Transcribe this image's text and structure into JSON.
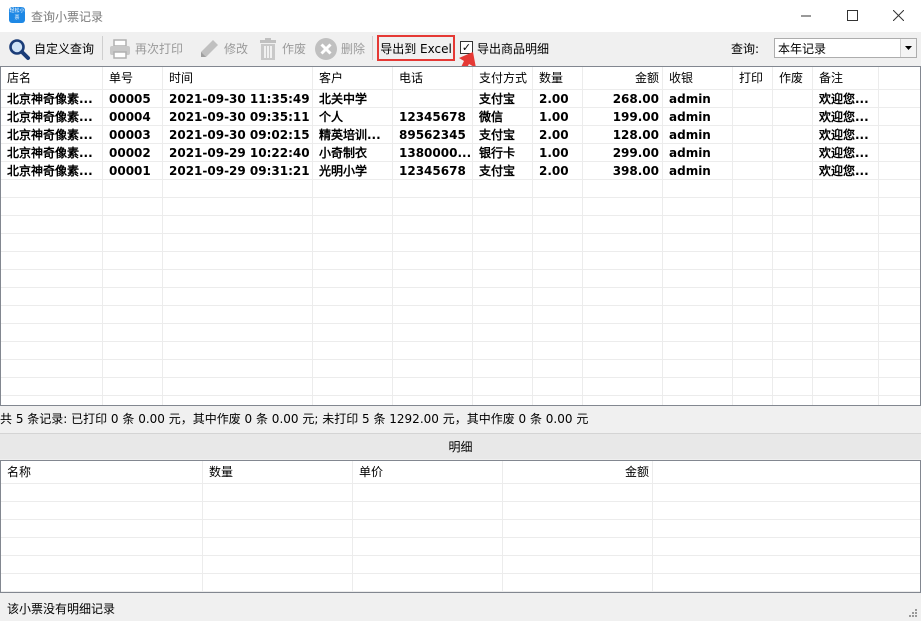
{
  "window": {
    "title": "查询小票记录",
    "icon_text": "轻松小票"
  },
  "toolbar": {
    "custom_query": "自定义查询",
    "reprint": "再次打印",
    "edit": "修改",
    "void": "作废",
    "delete": "删除",
    "export_excel": "导出到 Excel",
    "export_detail_label": "导出商品明细",
    "export_detail_checked": true,
    "query_label": "查询:",
    "query_value": "本年记录"
  },
  "main_table": {
    "columns": [
      "店名",
      "单号",
      "时间",
      "客户",
      "电话",
      "支付方式",
      "数量",
      "金额",
      "收银",
      "打印",
      "作废",
      "备注"
    ],
    "rows": [
      [
        "北京神奇像素...",
        "00005",
        "2021-09-30 11:35:49",
        "北关中学",
        "",
        "支付宝",
        "2.00",
        "268.00",
        "admin",
        "",
        "",
        "欢迎您..."
      ],
      [
        "北京神奇像素...",
        "00004",
        "2021-09-30 09:35:11",
        "个人",
        "12345678",
        "微信",
        "1.00",
        "199.00",
        "admin",
        "",
        "",
        "欢迎您..."
      ],
      [
        "北京神奇像素...",
        "00003",
        "2021-09-30 09:02:15",
        "精英培训...",
        "89562345",
        "支付宝",
        "2.00",
        "128.00",
        "admin",
        "",
        "",
        "欢迎您..."
      ],
      [
        "北京神奇像素...",
        "00002",
        "2021-09-29 10:22:40",
        "小奇制衣",
        "1380000...",
        "银行卡",
        "1.00",
        "299.00",
        "admin",
        "",
        "",
        "欢迎您..."
      ],
      [
        "北京神奇像素...",
        "00001",
        "2021-09-29 09:31:21",
        "光明小学",
        "12345678",
        "支付宝",
        "2.00",
        "398.00",
        "admin",
        "",
        "",
        "欢迎您..."
      ]
    ]
  },
  "summary": "共 5 条记录:  已打印 0 条 0.00 元，其中作废 0 条 0.00 元;  未打印 5 条 1292.00 元，其中作废 0 条 0.00 元",
  "detail": {
    "bar_label": "明细",
    "columns": [
      "名称",
      "数量",
      "单价",
      "金额"
    ],
    "rows": []
  },
  "status": "该小票没有明细记录"
}
